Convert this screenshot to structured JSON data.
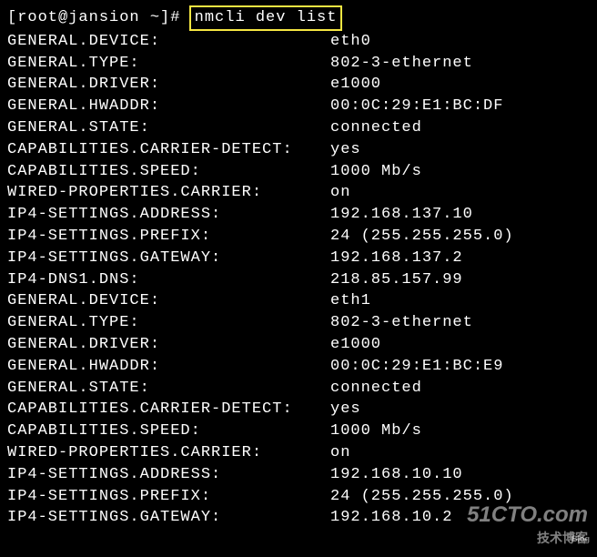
{
  "prompt": "[root@jansion ~]# ",
  "command": "nmcli dev list",
  "rows": [
    {
      "label": "GENERAL.DEVICE:",
      "value": "eth0"
    },
    {
      "label": "GENERAL.TYPE:",
      "value": "802-3-ethernet"
    },
    {
      "label": "GENERAL.DRIVER:",
      "value": "e1000"
    },
    {
      "label": "GENERAL.HWADDR:",
      "value": "00:0C:29:E1:BC:DF"
    },
    {
      "label": "GENERAL.STATE:",
      "value": "connected"
    },
    {
      "label": "CAPABILITIES.CARRIER-DETECT:",
      "value": "yes"
    },
    {
      "label": "CAPABILITIES.SPEED:",
      "value": "1000 Mb/s"
    },
    {
      "label": "WIRED-PROPERTIES.CARRIER:",
      "value": "on"
    },
    {
      "label": "IP4-SETTINGS.ADDRESS:",
      "value": "192.168.137.10"
    },
    {
      "label": "IP4-SETTINGS.PREFIX:",
      "value": "24 (255.255.255.0)"
    },
    {
      "label": "IP4-SETTINGS.GATEWAY:",
      "value": "192.168.137.2"
    },
    {
      "label": "IP4-DNS1.DNS:",
      "value": "218.85.157.99"
    },
    {
      "label": "GENERAL.DEVICE:",
      "value": "eth1"
    },
    {
      "label": "GENERAL.TYPE:",
      "value": "802-3-ethernet"
    },
    {
      "label": "GENERAL.DRIVER:",
      "value": "e1000"
    },
    {
      "label": "GENERAL.HWADDR:",
      "value": "00:0C:29:E1:BC:E9"
    },
    {
      "label": "GENERAL.STATE:",
      "value": "connected"
    },
    {
      "label": "CAPABILITIES.CARRIER-DETECT:",
      "value": "yes"
    },
    {
      "label": "CAPABILITIES.SPEED:",
      "value": "1000 Mb/s"
    },
    {
      "label": "WIRED-PROPERTIES.CARRIER:",
      "value": "on"
    },
    {
      "label": "IP4-SETTINGS.ADDRESS:",
      "value": "192.168.10.10"
    },
    {
      "label": "IP4-SETTINGS.PREFIX:",
      "value": "24 (255.255.255.0)"
    },
    {
      "label": "IP4-SETTINGS.GATEWAY:",
      "value": "192.168.10.2"
    }
  ],
  "watermark": {
    "main": "51CTO.com",
    "sub": "技术博客",
    "tiny": "Blog"
  }
}
